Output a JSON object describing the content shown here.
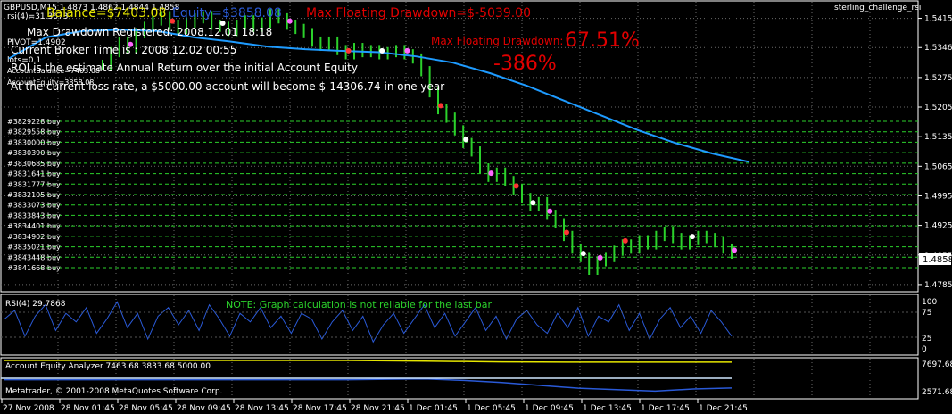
{
  "window": {
    "symbol_line": "GBPUSD,M15",
    "ohlc": "1.4873 1.4862 1.4844 1.4858",
    "expert_name": "sterling_challenge_rsi"
  },
  "overlay": {
    "balance": "Balance=$7403.08",
    "equity": "Equity=$3858.08",
    "max_floating_dd_money": "Max Floating Drawdown=$-5039.00",
    "max_floating_dd_pct_label": "Max Floating Drawdown:",
    "max_floating_dd_pct": "67.51%",
    "roi_value": "-386%",
    "max_dd_registered": "Max Drawdown Registered: 2008.12.01 18:18",
    "broker_time": "Current Broker Time is : 2008.12.02 00:55",
    "roi_note": "ROI is the estimate Annual Return over the initial Account Equity",
    "loss_rate_note": "At the current loss rate,  a $5000.00 account will become $-14306.74 in one year",
    "rsi_small": "rsi(4)=31.3673",
    "pivot_small": "PIVOT=1.4902",
    "lots_small": "lots=0.1",
    "account_balance_small": "AccountBalance=7403.08",
    "account_equity_small": "AccountEquity=3858.08"
  },
  "orders": [
    "#3829228 buy",
    "#3829558 buy",
    "#3830000 buy",
    "#3830390 buy",
    "#3830685 buy",
    "#3831641 buy",
    "#3831777 buy",
    "#3832105 buy",
    "#3833073 buy",
    "#3833843 buy",
    "#3834401 buy",
    "#3834902 buy",
    "#3835021 buy",
    "#3843448 buy",
    "#3841668 buy"
  ],
  "rsi_panel": {
    "label": "RSI(4) 29.7868",
    "note": "NOTE: Graph calculation is not reliable for the last bar",
    "levels": [
      "100",
      "75",
      "25",
      "0"
    ]
  },
  "equity_panel": {
    "label": "Account Equity Analyzer 7463.68 3833.68 5000.00",
    "copyright": "Metatrader, © 2001-2008 MetaQuotes Software Corp.",
    "levels": [
      "7697.68",
      "2571.68"
    ]
  },
  "chart_data": {
    "type": "line",
    "title": "GBPUSD,M15",
    "price_axis_ticks": [
      "1.5415",
      "1.5346",
      "1.5275",
      "1.5205",
      "1.5135",
      "1.5065",
      "1.4995",
      "1.4925",
      "1.4855",
      "1.4785"
    ],
    "current_price": "1.4858",
    "time_axis_ticks": [
      "27 Nov 2008",
      "28 Nov 01:45",
      "28 Nov 05:45",
      "28 Nov 09:45",
      "28 Nov 13:45",
      "28 Nov 17:45",
      "28 Nov 21:45",
      "1 Dec 01:45",
      "1 Dec 05:45",
      "1 Dec 09:45",
      "1 Dec 13:45",
      "1 Dec 17:45",
      "1 Dec 21:45"
    ],
    "ylim": [
      1.477,
      1.545
    ],
    "series": [
      {
        "kind": "price_close",
        "values": [
          1.5305,
          1.5335,
          1.536,
          1.5345,
          1.538,
          1.5395,
          1.541,
          1.542,
          1.54,
          1.539,
          1.5405,
          1.5415,
          1.542,
          1.54,
          1.5395,
          1.5385,
          1.54,
          1.541,
          1.5395,
          1.5405,
          1.5425,
          1.5415,
          1.54,
          1.539,
          1.538,
          1.536,
          1.535,
          1.536,
          1.534,
          1.533,
          1.5345,
          1.5335,
          1.534,
          1.533,
          1.5335,
          1.534,
          1.533,
          1.532,
          1.529,
          1.524,
          1.52,
          1.518,
          1.515,
          1.512,
          1.51,
          1.506,
          1.504,
          1.505,
          1.503,
          1.501,
          1.499,
          1.497,
          1.498,
          1.495,
          1.493,
          1.49,
          1.487,
          1.485,
          1.482,
          1.484,
          1.485,
          1.4865,
          1.488,
          1.487,
          1.489,
          1.488,
          1.49,
          1.491,
          1.4895,
          1.488,
          1.489,
          1.49,
          1.4895,
          1.4885,
          1.487,
          1.4858
        ]
      },
      {
        "kind": "moving_average",
        "values": [
          1.532,
          1.537,
          1.5385,
          1.5388,
          1.5385,
          1.537,
          1.536,
          1.5348,
          1.5342,
          1.5338,
          1.5335,
          1.5325,
          1.531,
          1.5285,
          1.5255,
          1.522,
          1.5185,
          1.515,
          1.512,
          1.5095,
          1.5075
        ]
      }
    ],
    "rsi": {
      "label": "RSI(4)",
      "ylim": [
        0,
        100
      ],
      "values": [
        60,
        75,
        30,
        65,
        85,
        40,
        70,
        55,
        80,
        35,
        60,
        90,
        45,
        70,
        25,
        65,
        80,
        50,
        75,
        40,
        85,
        60,
        30,
        70,
        55,
        80,
        45,
        65,
        35,
        70,
        60,
        25,
        55,
        75,
        40,
        65,
        20,
        50,
        70,
        35,
        60,
        85,
        45,
        70,
        30,
        55,
        80,
        40,
        65,
        25,
        60,
        75,
        50,
        35,
        70,
        45,
        80,
        30,
        65,
        55,
        85,
        40,
        70,
        25,
        60,
        80,
        45,
        65,
        35,
        75,
        55,
        30
      ]
    },
    "equity": {
      "label": "Account Equity Analyzer",
      "ylim": [
        2571.68,
        7697.68
      ],
      "balance_values": [
        7697,
        7697,
        7697,
        7697,
        7697,
        7697,
        7697,
        7697,
        7697,
        7697,
        7650,
        7600,
        7550,
        7500,
        7480,
        7463,
        7463,
        7463,
        7463,
        7463
      ],
      "equity_values": [
        5000,
        5000,
        5000,
        5000,
        5000,
        5000,
        5000,
        5000,
        5000,
        5000,
        5050,
        5100,
        4900,
        4600,
        4200,
        3800,
        3600,
        3400,
        3700,
        3833
      ]
    }
  }
}
